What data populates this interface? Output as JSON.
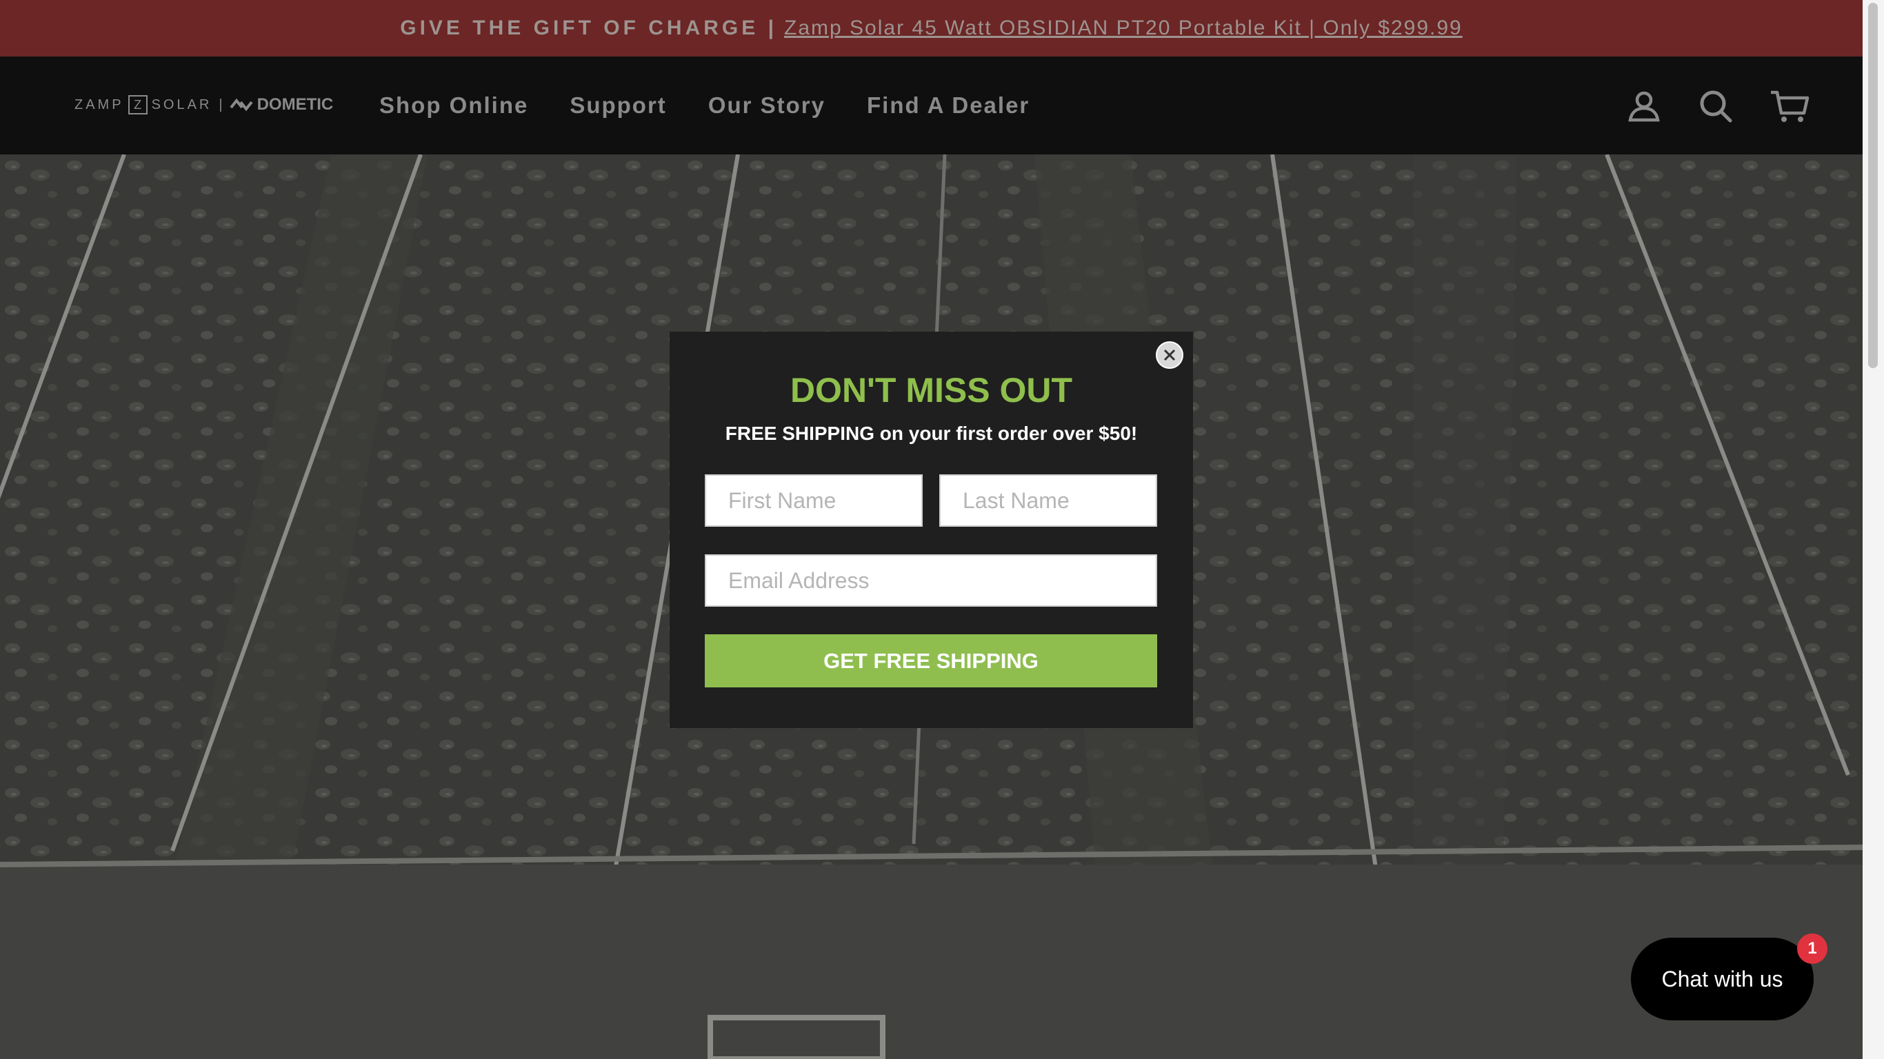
{
  "announcement": {
    "lead": "GIVE THE GIFT OF CHARGE |",
    "link": "Zamp Solar 45 Watt OBSIDIAN PT20 Portable Kit | Only $299.99"
  },
  "header": {
    "logo": {
      "zamp": "ZAMP",
      "z": "Z",
      "solar": "SOLAR",
      "sep": "|",
      "dometic": "DOMETIC"
    },
    "nav": [
      "Shop Online",
      "Support",
      "Our Story",
      "Find A Dealer"
    ],
    "icons": [
      "account-icon",
      "search-icon",
      "cart-icon"
    ]
  },
  "modal": {
    "title": "DON'T MISS OUT",
    "subtitle": "FREE SHIPPING on your first order over $50!",
    "first_name_placeholder": "First Name",
    "last_name_placeholder": "Last Name",
    "email_placeholder": "Email Address",
    "submit_label": "GET FREE SHIPPING",
    "close_icon": "close-icon"
  },
  "chat": {
    "label": "Chat with us",
    "badge": "1"
  },
  "colors": {
    "announcement_bg": "#6b2625",
    "header_bg": "#0f0f0f",
    "accent_green": "#8fbe4f",
    "modal_bg": "#1f1f1f",
    "badge_red": "#e0323f"
  }
}
